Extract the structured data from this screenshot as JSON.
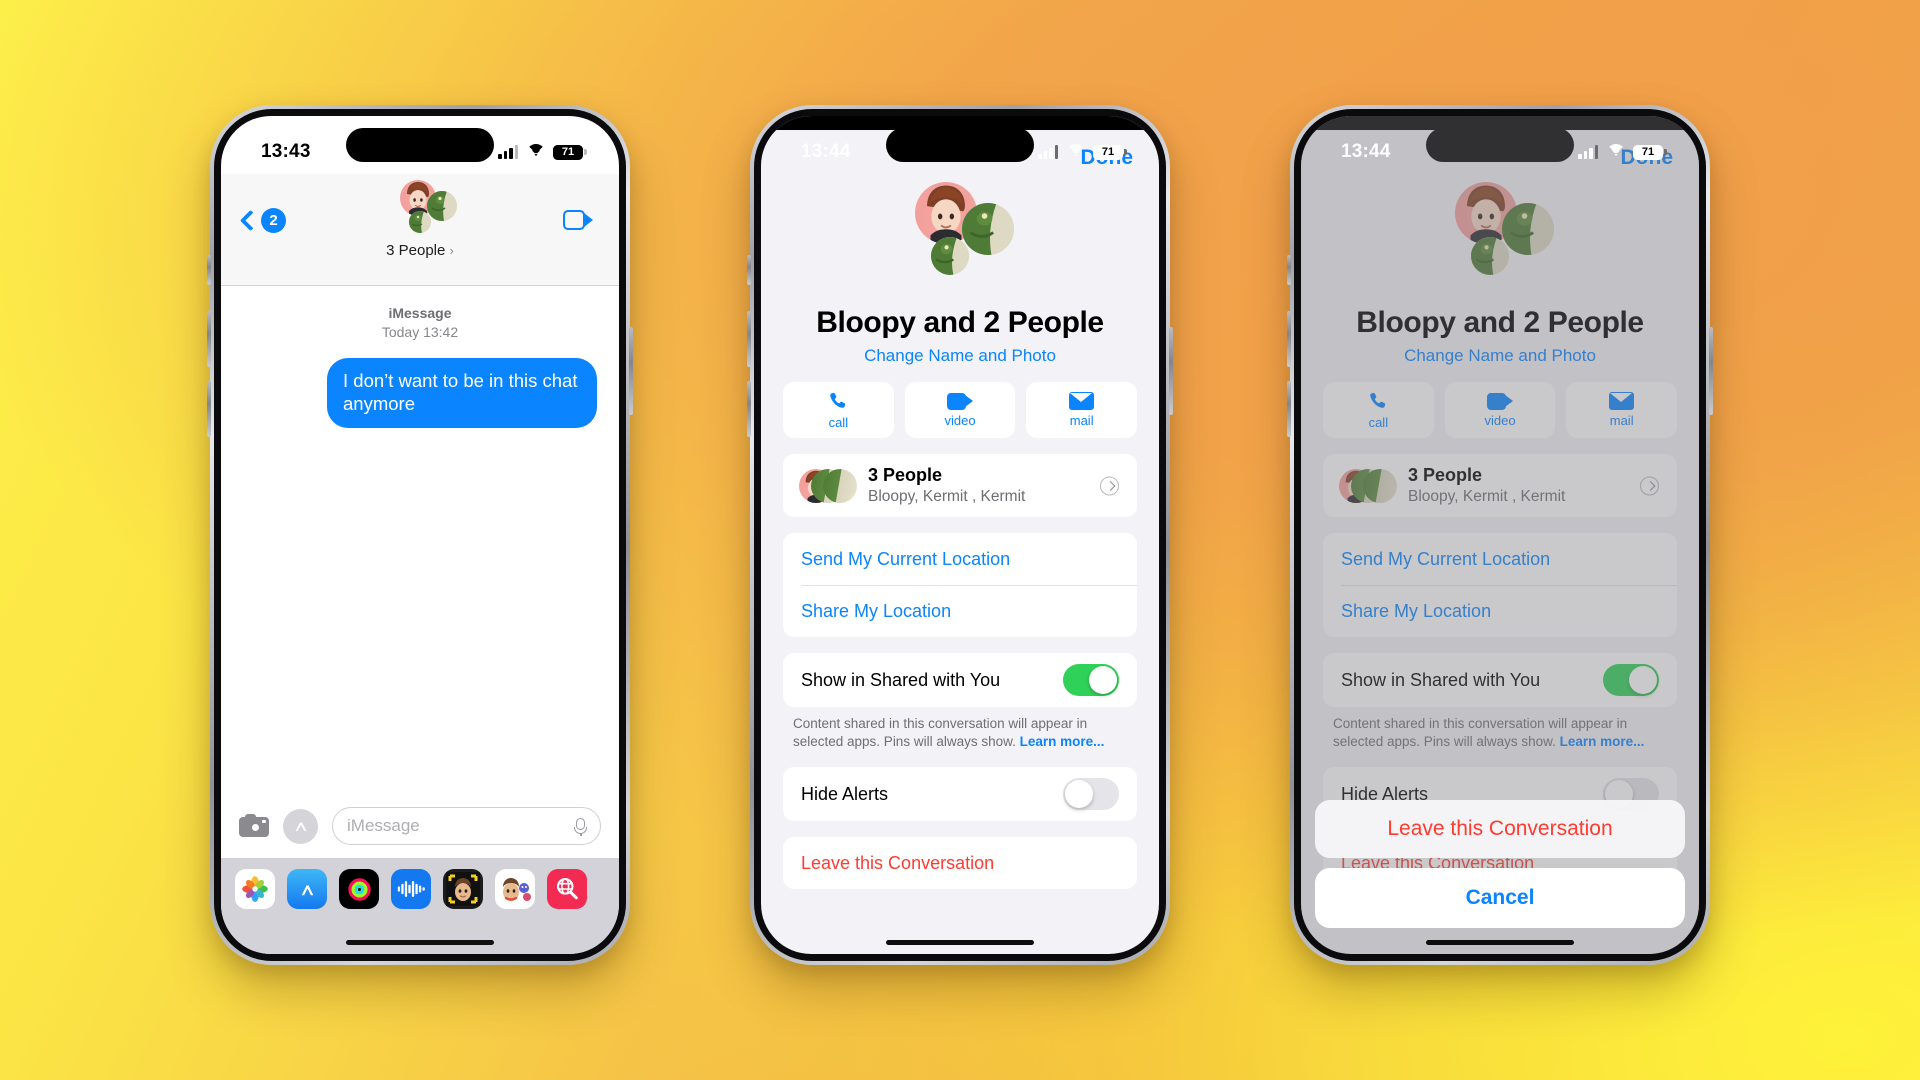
{
  "background": {
    "from": "#fdf04a",
    "to": "#eda23f"
  },
  "colors": {
    "accent": "#0a84ff",
    "danger": "#ff3b30",
    "toggle_on": "#30d158"
  },
  "phones": [
    {
      "id": "conversation",
      "status_bar": {
        "time": "13:43",
        "battery": "71",
        "wifi_icon": "wifi-icon",
        "signal_icon": "cellular-signal-icon",
        "battery_icon": "battery-icon"
      },
      "nav": {
        "back_icon": "back-chevron-icon",
        "back_badge": "2",
        "title": "3 People",
        "title_chevron": "›",
        "video_icon": "video-call-icon"
      },
      "thread": {
        "service": "iMessage",
        "timestamp": "Today 13:42",
        "messages": [
          {
            "sender": "me",
            "text": "I don’t want to be in this chat anymore"
          }
        ]
      },
      "composer": {
        "camera_icon": "camera-icon",
        "apps_icon": "app-store-icon",
        "placeholder": "iMessage",
        "value": "",
        "mic_icon": "microphone-icon"
      },
      "app_drawer": [
        {
          "name": "photos-app-icon",
          "label": "Photos"
        },
        {
          "name": "app-store-app-icon",
          "label": "App Store"
        },
        {
          "name": "fitness-app-icon",
          "label": "Fitness"
        },
        {
          "name": "audio-message-app-icon",
          "label": "Audio"
        },
        {
          "name": "memoji-app-icon",
          "label": "Memoji"
        },
        {
          "name": "memoji-stickers-app-icon",
          "label": "Memoji Stickers"
        },
        {
          "name": "images-app-icon",
          "label": "#images"
        }
      ]
    },
    {
      "id": "details",
      "status_bar": {
        "time": "13:44",
        "battery": "71",
        "wifi_icon": "wifi-icon",
        "signal_icon": "cellular-signal-icon",
        "battery_icon": "battery-icon"
      },
      "sheet": {
        "done_label": "Done",
        "group_title": "Bloopy and 2 People",
        "change_name_label": "Change Name and Photo",
        "actions": [
          {
            "icon": "phone-icon",
            "label": "call"
          },
          {
            "icon": "video-icon",
            "label": "video"
          },
          {
            "icon": "mail-icon",
            "label": "mail"
          }
        ],
        "people": {
          "title": "3 People",
          "subtitle": "Bloopy, Kermit , Kermit",
          "chevron_icon": "disclosure-chevron-icon"
        },
        "location": [
          "Send My Current Location",
          "Share My Location"
        ],
        "shared_with_you": {
          "label": "Show in Shared with You",
          "value": "on"
        },
        "footnote": "Content shared in this conversation will appear in selected apps. Pins will always show.",
        "footnote_link": "Learn more...",
        "hide_alerts": {
          "label": "Hide Alerts",
          "value": "off"
        },
        "leave_label": "Leave this Conversation"
      },
      "action_sheet": null
    },
    {
      "id": "details-with-action-sheet",
      "status_bar": {
        "time": "13:44",
        "battery": "71",
        "wifi_icon": "wifi-icon",
        "signal_icon": "cellular-signal-icon",
        "battery_icon": "battery-icon"
      },
      "sheet": {
        "done_label": "Done",
        "group_title": "Bloopy and 2 People",
        "change_name_label": "Change Name and Photo",
        "actions": [
          {
            "icon": "phone-icon",
            "label": "call"
          },
          {
            "icon": "video-icon",
            "label": "video"
          },
          {
            "icon": "mail-icon",
            "label": "mail"
          }
        ],
        "people": {
          "title": "3 People",
          "subtitle": "Bloopy, Kermit , Kermit",
          "chevron_icon": "disclosure-chevron-icon"
        },
        "location": [
          "Send My Current Location",
          "Share My Location"
        ],
        "shared_with_you": {
          "label": "Show in Shared with You",
          "value": "on"
        },
        "footnote": "Content shared in this conversation will appear in selected apps. Pins will always show.",
        "footnote_link": "Learn more...",
        "hide_alerts": {
          "label": "Hide Alerts",
          "value": "off"
        },
        "leave_label": "Leave this Conversation"
      },
      "action_sheet": {
        "destructive_label": "Leave this Conversation",
        "cancel_label": "Cancel"
      }
    }
  ]
}
